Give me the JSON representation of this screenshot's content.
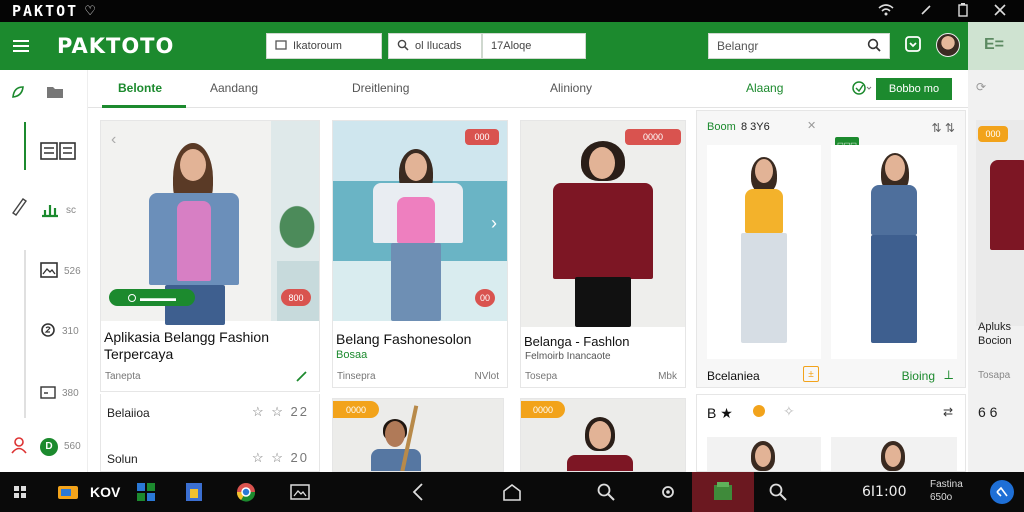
{
  "status_bar": {
    "title": "PAKTOT",
    "app_suffix": "♡"
  },
  "header": {
    "logo": "PAKTOTO",
    "field1": "Ikatoroum",
    "field2": "ol Ilucads",
    "field3": "17Aloqe",
    "search_placeholder": "Belangr"
  },
  "tabs": [
    {
      "label": "Belonte"
    },
    {
      "label": "Aandang"
    },
    {
      "label": "Dreitlening"
    },
    {
      "label": "Aliniony"
    },
    {
      "label": "Alaang"
    }
  ],
  "tab_button": "Bobbo mo",
  "sidebar": {
    "items": [
      {
        "icon": "leaf-icon",
        "value": ""
      },
      {
        "icon": "folder-icon",
        "value": ""
      },
      {
        "icon": "grid-icon",
        "value": ""
      },
      {
        "icon": "pen-icon",
        "value": ""
      },
      {
        "icon": "chart-icon",
        "value": "sc"
      },
      {
        "icon": "image-icon",
        "value": "526"
      },
      {
        "icon": "circle-icon",
        "value": "310"
      },
      {
        "icon": "box-icon",
        "value": "380"
      },
      {
        "icon": "user-icon",
        "value": "D 560"
      }
    ]
  },
  "cards": [
    {
      "title": "Aplikasia Belangg Fashion Terpercaya",
      "sub": "",
      "meta_left": "Tanepta",
      "meta_right": "",
      "badge": "",
      "pill": "",
      "badge2": "800"
    },
    {
      "title": "Belang Fashonesolon",
      "sub": "Bosaa",
      "meta_left": "Tinsepra",
      "meta_right": "NVlot",
      "badge": "000",
      "pill": "",
      "badge2": "00"
    },
    {
      "title": "Belanga - Fashlon",
      "sub": "Felmoirb Inancaote",
      "meta_left": "Tosepa",
      "meta_right": "Mbk",
      "badge": "0000",
      "pill": "",
      "badge2": ""
    }
  ],
  "list_rows": [
    {
      "label": "Belaiioa",
      "rating": "☆ ☆ 22"
    },
    {
      "label": "Solun",
      "rating": "☆ ☆ 20"
    }
  ],
  "bottom_badges": [
    "0000",
    "0000"
  ],
  "right_panel": {
    "header_left": "Boom",
    "header_mid": "8 3Y6",
    "header_badge": "▭▭▭",
    "header_icons": "⇅ ⇅",
    "footer_left": "Bcelaniea",
    "footer_right": "Bioing",
    "row2_left": "В ★",
    "row2_right": "⇄"
  },
  "ghost": {
    "badge": "000",
    "title": "Apluks Bocion",
    "meta": "Tosapa",
    "nums": "6 6"
  },
  "taskbar": {
    "label": "KOV",
    "clock": "6I1:00",
    "date": "Fastina 650o"
  }
}
